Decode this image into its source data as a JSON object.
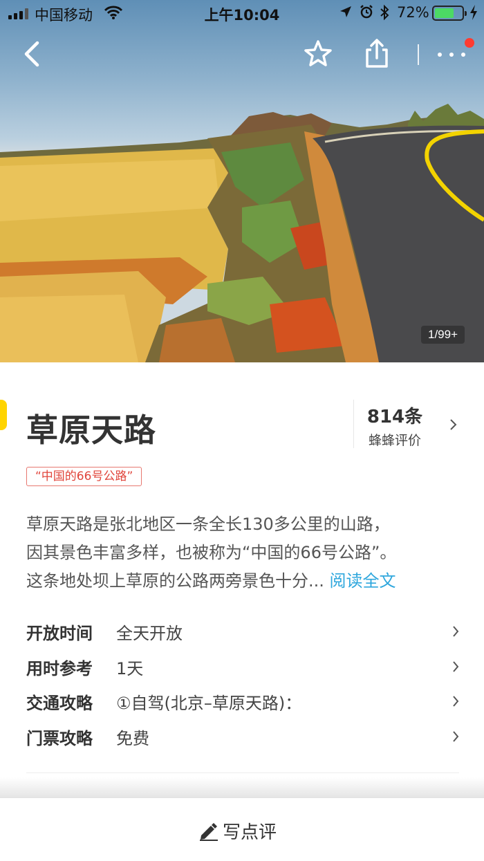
{
  "status_bar": {
    "carrier": "中国移动",
    "time": "上午10:04",
    "battery_percent": "72%",
    "battery_level": 0.72
  },
  "gallery": {
    "counter": "1/99+"
  },
  "poi": {
    "title": "草原天路",
    "tag": "“中国的66号公路”",
    "review_count": "814条",
    "review_label": "蜂蜂评价",
    "description_lines": [
      "草原天路是张北地区一条全长130多公里的山路，",
      "因其景色丰富多样，也被称为“中国的66号公路”。",
      "这条地处坝上草原的公路两旁景色十分..."
    ],
    "read_more": "阅读全文"
  },
  "info": [
    {
      "label": "开放时间",
      "value": "全天开放"
    },
    {
      "label": "用时参考",
      "value": "1天"
    },
    {
      "label": "交通攻略",
      "value": "①自驾(北京–草原天路)："
    },
    {
      "label": "门票攻略",
      "value": "免费"
    }
  ],
  "bottom_bar": {
    "write_review_label": "写点评"
  },
  "icons": [
    "signal-icon",
    "wifi-icon",
    "location-arrow-icon",
    "alarm-icon",
    "bluetooth-icon",
    "battery-icon",
    "charging-bolt-icon",
    "back-arrow-icon",
    "star-outline-icon",
    "share-icon",
    "more-dots-icon",
    "chevron-right-icon",
    "pencil-icon"
  ],
  "colors": {
    "accent_link": "#2fa7dd",
    "tag_red": "#e0443a",
    "brand_yellow": "#ffd400",
    "notification_red": "#ff3b30",
    "battery_green": "#4cd964"
  }
}
